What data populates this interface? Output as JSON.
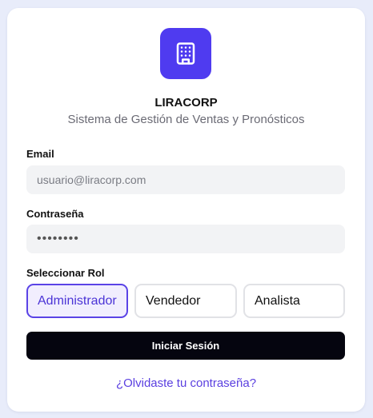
{
  "brand": {
    "name": "LIRACORP",
    "tagline": "Sistema de Gestión de Ventas y Pronósticos",
    "logo_icon": "building-icon",
    "accent_color": "#4f3bf0"
  },
  "form": {
    "email_label": "Email",
    "email_placeholder": "usuario@liracorp.com",
    "password_label": "Contraseña",
    "password_value": "••••••••",
    "role_label": "Seleccionar Rol",
    "roles": [
      "Administrador",
      "Vendedor",
      "Analista"
    ],
    "selected_role": "Administrador",
    "submit_label": "Iniciar Sesión",
    "forgot_link": "¿Olvidaste tu contraseña?"
  }
}
